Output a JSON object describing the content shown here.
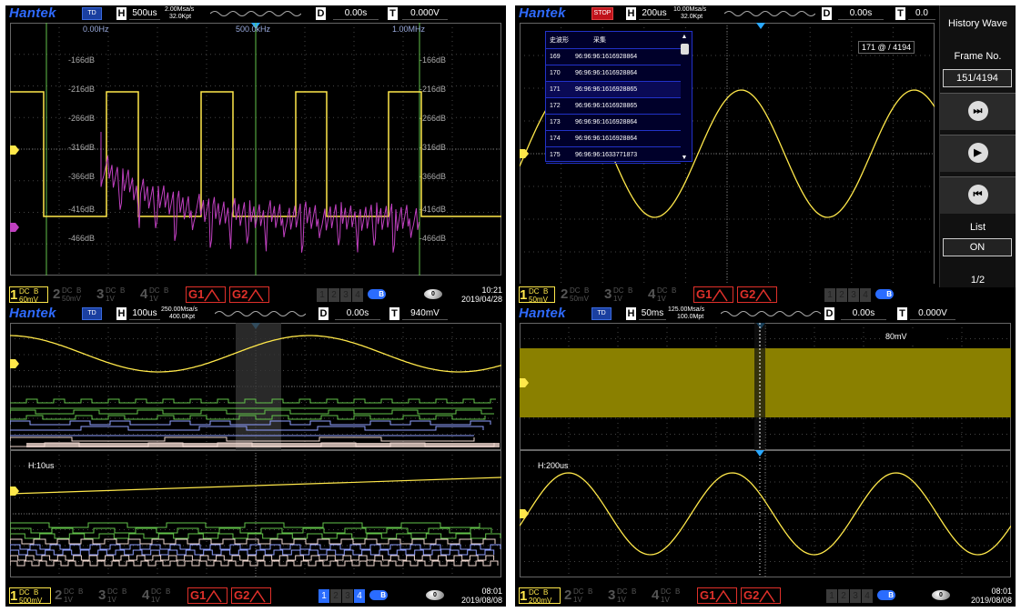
{
  "panels": [
    {
      "logo": "Hantek",
      "state": "TD",
      "h_label": "H",
      "timebase": "500us",
      "rate_top": "2.00Msa/s",
      "rate_bot": "32.0Kpt",
      "d_label": "D",
      "delay": "0.00s",
      "t_label": "T",
      "trig_level": "0.000V",
      "fft_x": [
        "0.00Hz",
        "500.0kHz",
        "1.00MHz"
      ],
      "fft_y": [
        "-166dB",
        "-216dB",
        "-266dB",
        "-316dB",
        "-366dB",
        "-416dB",
        "-466dB"
      ],
      "fft_y_right": [
        "-166dB",
        "-216dB",
        "-266dB",
        "-316dB",
        "-366dB",
        "-416dB",
        "-466dB"
      ],
      "marker": "M",
      "ch1": {
        "coupling": "DC",
        "bw": "B",
        "num": "1",
        "volts": "60mV"
      },
      "ch2": {
        "coupling": "DC",
        "bw": "B",
        "num": "2",
        "volts": "50mV"
      },
      "ch3": {
        "coupling": "DC",
        "bw": "B",
        "num": "3",
        "volts": "1V"
      },
      "ch4": {
        "coupling": "DC",
        "bw": "B",
        "num": "4",
        "volts": "1V"
      },
      "g1": "G1",
      "g2": "G2",
      "nums": [
        "1",
        "2",
        "3",
        "4"
      ],
      "bt_label": "B",
      "dial": "0",
      "time": "10:21",
      "date": "2019/04/28"
    },
    {
      "logo": "Hantek",
      "state": "STOP",
      "h_label": "H",
      "timebase": "200us",
      "rate_top": "10.00Msa/s",
      "rate_bot": "32.0Kpt",
      "d_label": "D",
      "delay": "0.00s",
      "t_label": "T",
      "trig_level": "0.0",
      "history": {
        "col1": "史波形",
        "col2": "采集",
        "rows": [
          {
            "n": "169",
            "t": "96:96:96:1616928864"
          },
          {
            "n": "170",
            "t": "96:96:96:1616928864"
          },
          {
            "n": "171",
            "t": "96:96:96:1616928865"
          },
          {
            "n": "172",
            "t": "96:96:96:1616928865"
          },
          {
            "n": "173",
            "t": "96:96:96:1616928864"
          },
          {
            "n": "174",
            "t": "96:96:96:1616928864"
          },
          {
            "n": "175",
            "t": "96:96:96:1633771873"
          }
        ],
        "up": "▲",
        "down": "▼"
      },
      "frame_readout": "171 @ / 4194",
      "sidebar": {
        "title": "History Wave",
        "frame_label": "Frame No.",
        "frame_value": "151/4194",
        "btn_end": "⏭",
        "btn_play": "▶",
        "btn_start": "⏮",
        "list_label": "List",
        "list_value": "ON",
        "page": "1/2"
      },
      "ch1": {
        "coupling": "DC",
        "bw": "B",
        "num": "1",
        "volts": "50mV"
      },
      "ch2": {
        "coupling": "DC",
        "bw": "B",
        "num": "2",
        "volts": "50mV"
      },
      "ch3": {
        "coupling": "DC",
        "bw": "B",
        "num": "3",
        "volts": "1V"
      },
      "ch4": {
        "coupling": "DC",
        "bw": "B",
        "num": "4",
        "volts": "1V"
      },
      "g1": "G1",
      "g2": "G2",
      "nums": [
        "1",
        "2",
        "3",
        "4"
      ],
      "bt_label": "B"
    },
    {
      "logo": "Hantek",
      "state": "TD",
      "h_label": "H",
      "timebase": "100us",
      "rate_top": "250.00Msa/s",
      "rate_bot": "400.0Kpt",
      "d_label": "D",
      "delay": "0.00s",
      "t_label": "T",
      "trig_level": "940mV",
      "zoom_label": "H:10us",
      "ch1": {
        "coupling": "DC",
        "bw": "B",
        "num": "1",
        "volts": "500mV"
      },
      "ch2": {
        "coupling": "DC",
        "bw": "B",
        "num": "2",
        "volts": "1V"
      },
      "ch3": {
        "coupling": "DC",
        "bw": "B",
        "num": "3",
        "volts": "1V"
      },
      "ch4": {
        "coupling": "DC",
        "bw": "B",
        "num": "4",
        "volts": "1V"
      },
      "g1": "G1",
      "g2": "G2",
      "nums": [
        "1",
        "2",
        "3",
        "4"
      ],
      "bt_label": "B",
      "dial": "0",
      "time": "08:01",
      "date": "2019/08/08"
    },
    {
      "logo": "Hantek",
      "state": "TD",
      "h_label": "H",
      "timebase": "50ms",
      "rate_top": "125.00Msa/s",
      "rate_bot": "100.0Mpt",
      "d_label": "D",
      "delay": "0.00s",
      "t_label": "T",
      "trig_level": "0.000V",
      "volt_readout": "80mV",
      "zoom_label": "H:200us",
      "ch1": {
        "coupling": "DC",
        "bw": "B",
        "num": "1",
        "volts": "200mV"
      },
      "ch2": {
        "coupling": "DC",
        "bw": "B",
        "num": "2",
        "volts": "1V"
      },
      "ch3": {
        "coupling": "DC",
        "bw": "B",
        "num": "3",
        "volts": "1V"
      },
      "ch4": {
        "coupling": "DC",
        "bw": "B",
        "num": "4",
        "volts": "1V"
      },
      "g1": "G1",
      "g2": "G2",
      "nums": [
        "1",
        "2",
        "3",
        "4"
      ],
      "bt_label": "B",
      "dial": "0",
      "time": "08:01",
      "date": "2019/08/08"
    }
  ],
  "colors": {
    "ch1": "#ffe84a",
    "math": "#c040c0",
    "digital": "#62c24a",
    "bus": "#f0d8d0",
    "grid": "#3a3a3a",
    "brand": "#2f6bff",
    "stop": "#c0121a"
  }
}
